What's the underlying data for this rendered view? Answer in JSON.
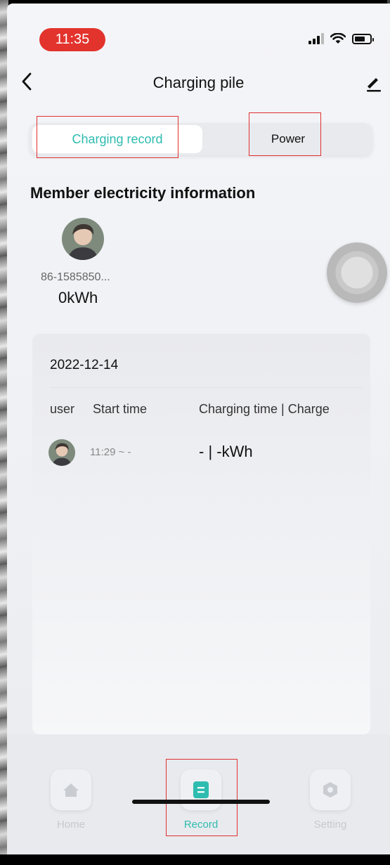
{
  "status_bar": {
    "time": "11:35"
  },
  "header": {
    "title": "Charging pile"
  },
  "tabs": [
    {
      "label": "Charging record",
      "active": true
    },
    {
      "label": "Power",
      "active": false
    }
  ],
  "member_section": {
    "title": "Member electricity information",
    "member": {
      "phone": "86-1585850...",
      "energy": "0kWh"
    }
  },
  "record_card": {
    "date": "2022-12-14",
    "columns": [
      "user",
      "Start time",
      "Charging time | Charge"
    ],
    "rows": [
      {
        "start_time": "11:29 ~ -",
        "charge": "- | -kWh"
      }
    ]
  },
  "bottom_nav": [
    {
      "label": "Home",
      "icon": "home-icon",
      "active": false
    },
    {
      "label": "Record",
      "icon": "record-icon",
      "active": true
    },
    {
      "label": "Setting",
      "icon": "setting-icon",
      "active": false
    }
  ],
  "colors": {
    "accent": "#2ebcb0",
    "time_pill": "#e3332d",
    "highlight": "#e03030"
  }
}
